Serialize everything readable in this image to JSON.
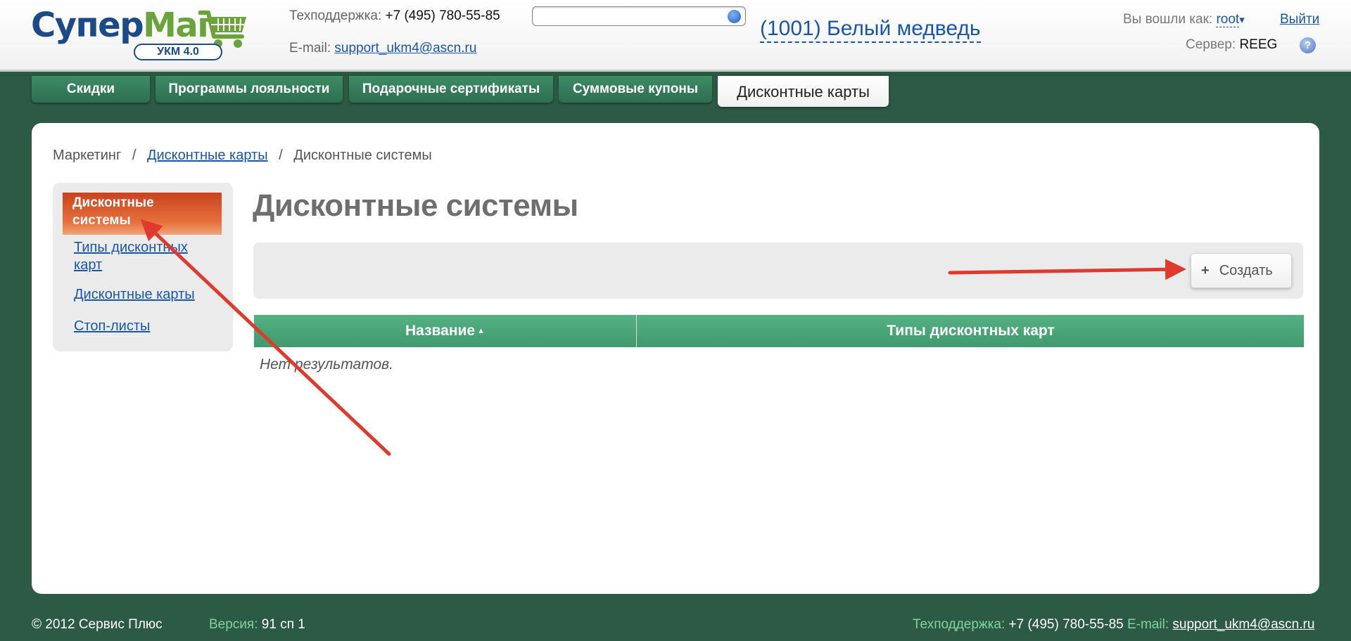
{
  "header": {
    "logo_part1": "Супер",
    "logo_part2": "Маг",
    "logo_badge": "УКМ 4.0",
    "support_phone_label": "Техподдержка:",
    "support_phone": "+7 (495) 780-55-85",
    "support_email_label": "E-mail:",
    "support_email": "support_ukm4@ascn.ru",
    "search_placeholder": "",
    "shop": "(1001) Белый медведь",
    "logged_in_label": "Вы вошли как:",
    "user": "root",
    "user_caret": "▾",
    "logout": "Выйти",
    "server_label": "Сервер:",
    "server": "REEG",
    "help": "?"
  },
  "tabs": [
    {
      "label": "Скидки",
      "active": false
    },
    {
      "label": "Программы лояльности",
      "active": false
    },
    {
      "label": "Подарочные сертификаты",
      "active": false
    },
    {
      "label": "Суммовые купоны",
      "active": false
    },
    {
      "label": "Дисконтные карты",
      "active": true
    }
  ],
  "breadcrumb": {
    "root": "Маркетинг",
    "sep": "/",
    "link": "Дисконтные карты",
    "current": "Дисконтные системы"
  },
  "sidebar": {
    "items": [
      {
        "label": "Дисконтные системы",
        "active": true
      },
      {
        "label": "Типы дисконтных карт",
        "active": false
      },
      {
        "label": "Дисконтные карты",
        "active": false
      },
      {
        "label": "Стоп-листы",
        "active": false
      }
    ]
  },
  "main": {
    "title": "Дисконтные системы",
    "create_icon": "+",
    "create_label": "Создать",
    "columns": [
      "Название",
      "Типы дисконтных карт"
    ],
    "sort_indicator": "▲",
    "empty_text": "Нет результатов."
  },
  "footer": {
    "copyright": "© 2012 Сервис Плюс",
    "version_label": "Версия:",
    "version": "91 сп 1",
    "support_label": "Техподдержка:",
    "support_phone": "+7 (495) 780-55-85",
    "email_label": "E-mail:",
    "email": "support_ukm4@ascn.ru"
  },
  "colors": {
    "background": "#2c5a44",
    "accent_tab": "#2d6e4f",
    "table_header": "#4aa678",
    "active_nav": "#d9552a",
    "link": "#1a56a8",
    "annotation_arrow": "#e03a2f"
  }
}
